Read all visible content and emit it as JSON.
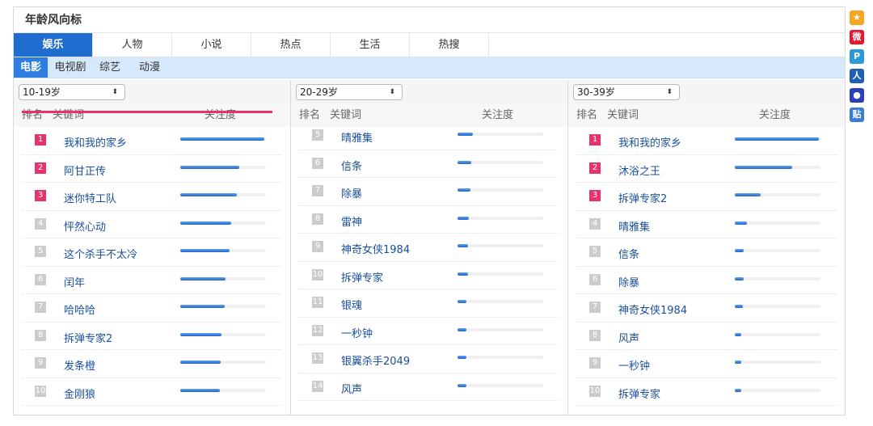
{
  "widget": {
    "title": "年龄风向标"
  },
  "main_tabs": [
    {
      "label": "娱乐",
      "active": true
    },
    {
      "label": "人物",
      "active": false
    },
    {
      "label": "小说",
      "active": false
    },
    {
      "label": "热点",
      "active": false
    },
    {
      "label": "生活",
      "active": false
    },
    {
      "label": "热搜",
      "active": false
    }
  ],
  "sub_tabs": [
    {
      "label": "电影",
      "active": true
    },
    {
      "label": "电视剧",
      "active": false
    },
    {
      "label": "综艺",
      "active": false
    },
    {
      "label": "动漫",
      "active": false
    }
  ],
  "list_header": {
    "rank": "排名",
    "keyword": "关键词",
    "attention": "关注度"
  },
  "columns": [
    {
      "age": "10-19岁",
      "rows": [
        {
          "rank": "1",
          "keyword": "我和我的家乡",
          "attention": 0.98
        },
        {
          "rank": "2",
          "keyword": "阿甘正传",
          "attention": 0.69
        },
        {
          "rank": "3",
          "keyword": "迷你特工队",
          "attention": 0.66
        },
        {
          "rank": "4",
          "keyword": "怦然心动",
          "attention": 0.59
        },
        {
          "rank": "5",
          "keyword": "这个杀手不太冷",
          "attention": 0.58
        },
        {
          "rank": "6",
          "keyword": "闰年",
          "attention": 0.53
        },
        {
          "rank": "7",
          "keyword": "哈哈哈",
          "attention": 0.52
        },
        {
          "rank": "8",
          "keyword": "拆弹专家2",
          "attention": 0.48
        },
        {
          "rank": "9",
          "keyword": "发条橙",
          "attention": 0.47
        },
        {
          "rank": "10",
          "keyword": "金刚狼",
          "attention": 0.46
        }
      ]
    },
    {
      "age": "20-29岁",
      "rows": [
        {
          "rank": "5",
          "keyword": "晴雅集",
          "attention": 0.18
        },
        {
          "rank": "6",
          "keyword": "信条",
          "attention": 0.16
        },
        {
          "rank": "7",
          "keyword": "除暴",
          "attention": 0.15
        },
        {
          "rank": "8",
          "keyword": "雷神",
          "attention": 0.13
        },
        {
          "rank": "9",
          "keyword": "神奇女侠1984",
          "attention": 0.12
        },
        {
          "rank": "10",
          "keyword": "拆弹专家",
          "attention": 0.12
        },
        {
          "rank": "11",
          "keyword": "银魂",
          "attention": 0.1
        },
        {
          "rank": "12",
          "keyword": "一秒钟",
          "attention": 0.1
        },
        {
          "rank": "13",
          "keyword": "银翼杀手2049",
          "attention": 0.1
        },
        {
          "rank": "14",
          "keyword": "风声",
          "attention": 0.1
        }
      ]
    },
    {
      "age": "30-39岁",
      "rows": [
        {
          "rank": "1",
          "keyword": "我和我的家乡",
          "attention": 0.98
        },
        {
          "rank": "2",
          "keyword": "沐浴之王",
          "attention": 0.67
        },
        {
          "rank": "3",
          "keyword": "拆弹专家2",
          "attention": 0.3
        },
        {
          "rank": "4",
          "keyword": "晴雅集",
          "attention": 0.14
        },
        {
          "rank": "5",
          "keyword": "信条",
          "attention": 0.1
        },
        {
          "rank": "6",
          "keyword": "除暴",
          "attention": 0.1
        },
        {
          "rank": "7",
          "keyword": "神奇女侠1984",
          "attention": 0.09
        },
        {
          "rank": "8",
          "keyword": "风声",
          "attention": 0.08
        },
        {
          "rank": "9",
          "keyword": "一秒钟",
          "attention": 0.08
        },
        {
          "rank": "10",
          "keyword": "拆弹专家",
          "attention": 0.08
        }
      ]
    }
  ],
  "side_icons": [
    {
      "name": "qzone-star-icon",
      "glyph": "★",
      "color": "#f5a623"
    },
    {
      "name": "weibo-icon",
      "glyph": "微",
      "color": "#e6162d"
    },
    {
      "name": "tieba-icon",
      "glyph": "P",
      "color": "#2a9bd8"
    },
    {
      "name": "renren-icon",
      "glyph": "人",
      "color": "#1f5fb8"
    },
    {
      "name": "baidu-paw-icon",
      "glyph": "●",
      "color": "#2b3fb8"
    },
    {
      "name": "tieba-post-icon",
      "glyph": "贴",
      "color": "#3a7bd5"
    }
  ],
  "colors": {
    "accent": "#1f6dcf",
    "top_rank": "#e6336a",
    "link": "#1a4f9e"
  }
}
